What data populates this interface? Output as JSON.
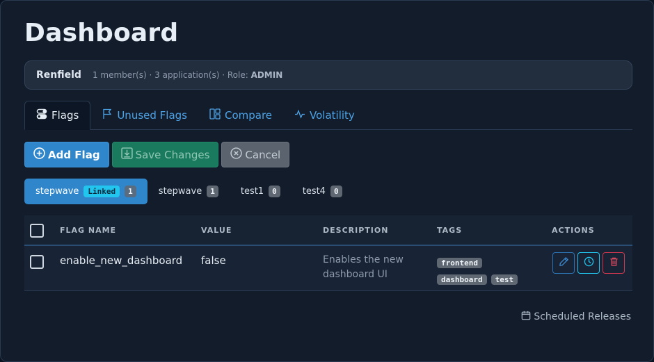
{
  "page": {
    "title": "Dashboard"
  },
  "org": {
    "name": "Renfield",
    "meta": "1 member(s) · 3 application(s) · Role: ",
    "role": "ADMIN"
  },
  "tabs": [
    {
      "label": "Flags",
      "icon": "toggle-icon",
      "active": true
    },
    {
      "label": "Unused Flags",
      "icon": "flag-icon"
    },
    {
      "label": "Compare",
      "icon": "compare-icon"
    },
    {
      "label": "Volatility",
      "icon": "activity-icon"
    }
  ],
  "actions": {
    "add_label": "Add Flag",
    "save_label": "Save Changes",
    "cancel_label": "Cancel"
  },
  "apps": [
    {
      "name": "stepwave",
      "linked_label": "Linked",
      "count": "1",
      "active": true
    },
    {
      "name": "stepwave",
      "count": "1"
    },
    {
      "name": "test1",
      "count": "0"
    },
    {
      "name": "test4",
      "count": "0"
    }
  ],
  "table": {
    "headers": {
      "flag_name": "FLAG NAME",
      "value": "VALUE",
      "description": "DESCRIPTION",
      "tags": "TAGS",
      "actions": "ACTIONS"
    },
    "rows": [
      {
        "name": "enable_new_dashboard",
        "value": "false",
        "description": "Enables the new dashboard UI",
        "tags": [
          "frontend",
          "dashboard",
          "test"
        ]
      }
    ]
  },
  "footer": {
    "scheduled_label": "Scheduled Releases"
  },
  "colors": {
    "accent": "#2f86cb",
    "success": "#1a7a5e",
    "linked": "#22c5ee",
    "danger": "#d0384d"
  }
}
